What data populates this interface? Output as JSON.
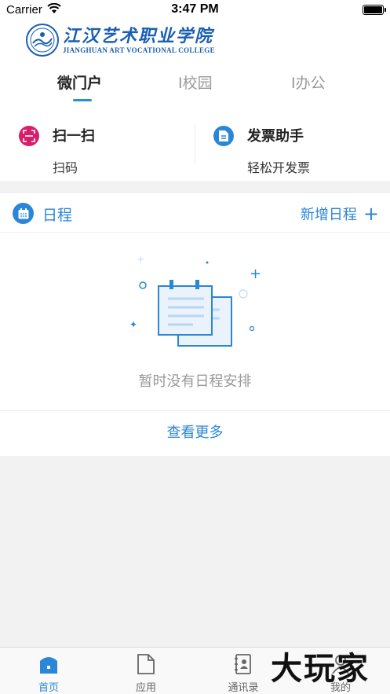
{
  "status_bar": {
    "carrier": "Carrier",
    "time": "3:47 PM"
  },
  "header": {
    "logo_cn": "江汉艺术职业学院",
    "logo_en": "JIANGHUAN ART VOCATIONAL COLLEGE",
    "tabs": [
      {
        "label": "微门户",
        "active": true
      },
      {
        "label": "I校园",
        "active": false
      },
      {
        "label": "I办公",
        "active": false
      }
    ]
  },
  "quick_actions": [
    {
      "title": "扫一扫",
      "subtitle": "扫码",
      "icon": "scan-icon",
      "color": "#d81e6a"
    },
    {
      "title": "发票助手",
      "subtitle": "轻松开发票",
      "icon": "invoice-icon",
      "color": "#2a86d6"
    }
  ],
  "schedule": {
    "title": "日程",
    "add_label": "新增日程",
    "empty_text": "暂时没有日程安排",
    "view_more": "查看更多"
  },
  "tabbar": [
    {
      "label": "首页",
      "icon": "home-icon",
      "active": true
    },
    {
      "label": "应用",
      "icon": "app-icon",
      "active": false
    },
    {
      "label": "通讯录",
      "icon": "contacts-icon",
      "active": false
    },
    {
      "label": "我的",
      "icon": "profile-icon",
      "active": false
    }
  ],
  "watermark": "大玩家",
  "colors": {
    "accent": "#2a86d6",
    "scan": "#d81e6a",
    "background": "#f2f2f2"
  }
}
